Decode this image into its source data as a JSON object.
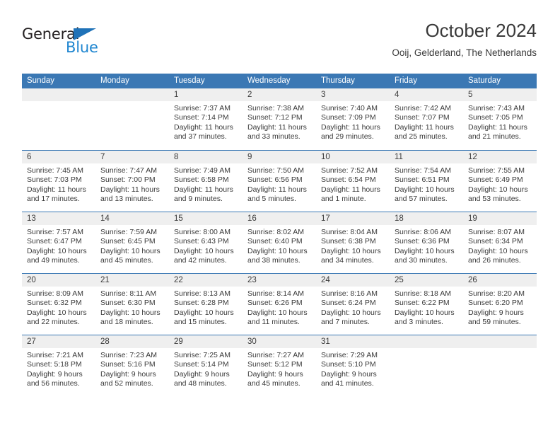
{
  "brand": {
    "name_top": "General",
    "name_bottom": "Blue",
    "triangle_color": "#1f72b8",
    "blue_color": "#1f86d0"
  },
  "header": {
    "title": "October 2024",
    "subtitle": "Ooij, Gelderland, The Netherlands"
  },
  "theme": {
    "header_blue": "#3b78b4",
    "daynum_band": "#efefef",
    "text": "#3a3a3a"
  },
  "weekdays": [
    "Sunday",
    "Monday",
    "Tuesday",
    "Wednesday",
    "Thursday",
    "Friday",
    "Saturday"
  ],
  "weeks": [
    [
      {
        "day": "",
        "empty": true
      },
      {
        "day": "",
        "empty": true
      },
      {
        "day": "1",
        "sunrise": "Sunrise: 7:37 AM",
        "sunset": "Sunset: 7:14 PM",
        "daylight": "Daylight: 11 hours and 37 minutes."
      },
      {
        "day": "2",
        "sunrise": "Sunrise: 7:38 AM",
        "sunset": "Sunset: 7:12 PM",
        "daylight": "Daylight: 11 hours and 33 minutes."
      },
      {
        "day": "3",
        "sunrise": "Sunrise: 7:40 AM",
        "sunset": "Sunset: 7:09 PM",
        "daylight": "Daylight: 11 hours and 29 minutes."
      },
      {
        "day": "4",
        "sunrise": "Sunrise: 7:42 AM",
        "sunset": "Sunset: 7:07 PM",
        "daylight": "Daylight: 11 hours and 25 minutes."
      },
      {
        "day": "5",
        "sunrise": "Sunrise: 7:43 AM",
        "sunset": "Sunset: 7:05 PM",
        "daylight": "Daylight: 11 hours and 21 minutes."
      }
    ],
    [
      {
        "day": "6",
        "sunrise": "Sunrise: 7:45 AM",
        "sunset": "Sunset: 7:03 PM",
        "daylight": "Daylight: 11 hours and 17 minutes."
      },
      {
        "day": "7",
        "sunrise": "Sunrise: 7:47 AM",
        "sunset": "Sunset: 7:00 PM",
        "daylight": "Daylight: 11 hours and 13 minutes."
      },
      {
        "day": "8",
        "sunrise": "Sunrise: 7:49 AM",
        "sunset": "Sunset: 6:58 PM",
        "daylight": "Daylight: 11 hours and 9 minutes."
      },
      {
        "day": "9",
        "sunrise": "Sunrise: 7:50 AM",
        "sunset": "Sunset: 6:56 PM",
        "daylight": "Daylight: 11 hours and 5 minutes."
      },
      {
        "day": "10",
        "sunrise": "Sunrise: 7:52 AM",
        "sunset": "Sunset: 6:54 PM",
        "daylight": "Daylight: 11 hours and 1 minute."
      },
      {
        "day": "11",
        "sunrise": "Sunrise: 7:54 AM",
        "sunset": "Sunset: 6:51 PM",
        "daylight": "Daylight: 10 hours and 57 minutes."
      },
      {
        "day": "12",
        "sunrise": "Sunrise: 7:55 AM",
        "sunset": "Sunset: 6:49 PM",
        "daylight": "Daylight: 10 hours and 53 minutes."
      }
    ],
    [
      {
        "day": "13",
        "sunrise": "Sunrise: 7:57 AM",
        "sunset": "Sunset: 6:47 PM",
        "daylight": "Daylight: 10 hours and 49 minutes."
      },
      {
        "day": "14",
        "sunrise": "Sunrise: 7:59 AM",
        "sunset": "Sunset: 6:45 PM",
        "daylight": "Daylight: 10 hours and 45 minutes."
      },
      {
        "day": "15",
        "sunrise": "Sunrise: 8:00 AM",
        "sunset": "Sunset: 6:43 PM",
        "daylight": "Daylight: 10 hours and 42 minutes."
      },
      {
        "day": "16",
        "sunrise": "Sunrise: 8:02 AM",
        "sunset": "Sunset: 6:40 PM",
        "daylight": "Daylight: 10 hours and 38 minutes."
      },
      {
        "day": "17",
        "sunrise": "Sunrise: 8:04 AM",
        "sunset": "Sunset: 6:38 PM",
        "daylight": "Daylight: 10 hours and 34 minutes."
      },
      {
        "day": "18",
        "sunrise": "Sunrise: 8:06 AM",
        "sunset": "Sunset: 6:36 PM",
        "daylight": "Daylight: 10 hours and 30 minutes."
      },
      {
        "day": "19",
        "sunrise": "Sunrise: 8:07 AM",
        "sunset": "Sunset: 6:34 PM",
        "daylight": "Daylight: 10 hours and 26 minutes."
      }
    ],
    [
      {
        "day": "20",
        "sunrise": "Sunrise: 8:09 AM",
        "sunset": "Sunset: 6:32 PM",
        "daylight": "Daylight: 10 hours and 22 minutes."
      },
      {
        "day": "21",
        "sunrise": "Sunrise: 8:11 AM",
        "sunset": "Sunset: 6:30 PM",
        "daylight": "Daylight: 10 hours and 18 minutes."
      },
      {
        "day": "22",
        "sunrise": "Sunrise: 8:13 AM",
        "sunset": "Sunset: 6:28 PM",
        "daylight": "Daylight: 10 hours and 15 minutes."
      },
      {
        "day": "23",
        "sunrise": "Sunrise: 8:14 AM",
        "sunset": "Sunset: 6:26 PM",
        "daylight": "Daylight: 10 hours and 11 minutes."
      },
      {
        "day": "24",
        "sunrise": "Sunrise: 8:16 AM",
        "sunset": "Sunset: 6:24 PM",
        "daylight": "Daylight: 10 hours and 7 minutes."
      },
      {
        "day": "25",
        "sunrise": "Sunrise: 8:18 AM",
        "sunset": "Sunset: 6:22 PM",
        "daylight": "Daylight: 10 hours and 3 minutes."
      },
      {
        "day": "26",
        "sunrise": "Sunrise: 8:20 AM",
        "sunset": "Sunset: 6:20 PM",
        "daylight": "Daylight: 9 hours and 59 minutes."
      }
    ],
    [
      {
        "day": "27",
        "sunrise": "Sunrise: 7:21 AM",
        "sunset": "Sunset: 5:18 PM",
        "daylight": "Daylight: 9 hours and 56 minutes."
      },
      {
        "day": "28",
        "sunrise": "Sunrise: 7:23 AM",
        "sunset": "Sunset: 5:16 PM",
        "daylight": "Daylight: 9 hours and 52 minutes."
      },
      {
        "day": "29",
        "sunrise": "Sunrise: 7:25 AM",
        "sunset": "Sunset: 5:14 PM",
        "daylight": "Daylight: 9 hours and 48 minutes."
      },
      {
        "day": "30",
        "sunrise": "Sunrise: 7:27 AM",
        "sunset": "Sunset: 5:12 PM",
        "daylight": "Daylight: 9 hours and 45 minutes."
      },
      {
        "day": "31",
        "sunrise": "Sunrise: 7:29 AM",
        "sunset": "Sunset: 5:10 PM",
        "daylight": "Daylight: 9 hours and 41 minutes."
      },
      {
        "day": "",
        "empty": true
      },
      {
        "day": "",
        "empty": true
      }
    ]
  ]
}
